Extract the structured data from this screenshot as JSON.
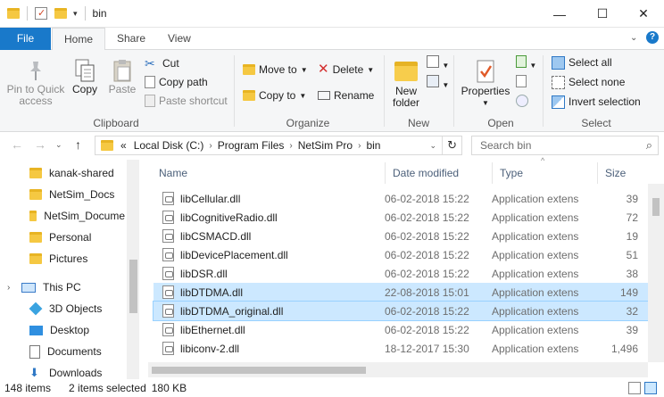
{
  "window": {
    "title": "bin",
    "minimize": "—",
    "maximize": "☐",
    "close": "✕"
  },
  "tabs": {
    "file": "File",
    "home": "Home",
    "share": "Share",
    "view": "View"
  },
  "ribbon": {
    "clipboard": {
      "pin": "Pin to Quick access",
      "pin_l1": "Pin to Quick",
      "pin_l2": "access",
      "copy": "Copy",
      "paste": "Paste",
      "cut": "Cut",
      "copy_path": "Copy path",
      "paste_shortcut": "Paste shortcut",
      "label": "Clipboard"
    },
    "organize": {
      "move_to": "Move to",
      "copy_to": "Copy to",
      "delete": "Delete",
      "rename": "Rename",
      "label": "Organize"
    },
    "new": {
      "new_folder_l1": "New",
      "new_folder_l2": "folder",
      "label": "New"
    },
    "open": {
      "properties": "Properties",
      "label": "Open"
    },
    "select": {
      "select_all": "Select all",
      "select_none": "Select none",
      "invert": "Invert selection",
      "label": "Select"
    }
  },
  "address": {
    "crumbs": [
      "Local Disk (C:)",
      "Program Files",
      "NetSim Pro",
      "bin"
    ],
    "overflow": "«",
    "search_placeholder": "Search bin"
  },
  "nav": {
    "items": [
      {
        "label": "kanak-shared",
        "icon": "folder-icon"
      },
      {
        "label": "NetSim_Docs",
        "icon": "folder-icon"
      },
      {
        "label": "NetSim_Docume",
        "icon": "folder-icon"
      },
      {
        "label": "Personal",
        "icon": "folder-icon"
      },
      {
        "label": "Pictures",
        "icon": "folder-icon"
      },
      {
        "label": "This PC",
        "icon": "computer-icon"
      },
      {
        "label": "3D Objects",
        "icon": "cube-icon"
      },
      {
        "label": "Desktop",
        "icon": "desktop-icon"
      },
      {
        "label": "Documents",
        "icon": "document-icon"
      },
      {
        "label": "Downloads",
        "icon": "download-icon"
      }
    ]
  },
  "columns": {
    "name": "Name",
    "date": "Date modified",
    "type": "Type",
    "size": "Size"
  },
  "files": [
    {
      "name": "libCellular.dll",
      "date": "06-02-2018 15:22",
      "type": "Application extens",
      "size": "39"
    },
    {
      "name": "libCognitiveRadio.dll",
      "date": "06-02-2018 15:22",
      "type": "Application extens",
      "size": "72"
    },
    {
      "name": "libCSMACD.dll",
      "date": "06-02-2018 15:22",
      "type": "Application extens",
      "size": "19"
    },
    {
      "name": "libDevicePlacement.dll",
      "date": "06-02-2018 15:22",
      "type": "Application extens",
      "size": "51"
    },
    {
      "name": "libDSR.dll",
      "date": "06-02-2018 15:22",
      "type": "Application extens",
      "size": "38"
    },
    {
      "name": "libDTDMA.dll",
      "date": "22-08-2018 15:01",
      "type": "Application extens",
      "size": "149"
    },
    {
      "name": "libDTDMA_original.dll",
      "date": "06-02-2018 15:22",
      "type": "Application extens",
      "size": "32"
    },
    {
      "name": "libEthernet.dll",
      "date": "06-02-2018 15:22",
      "type": "Application extens",
      "size": "39"
    },
    {
      "name": "libiconv-2.dll",
      "date": "18-12-2017 15:30",
      "type": "Application extens",
      "size": "1,496"
    }
  ],
  "status": {
    "count": "148 items",
    "selected": "2 items selected",
    "size": "180 KB"
  },
  "colors": {
    "accent": "#1979ca",
    "selection": "#cce8ff"
  }
}
